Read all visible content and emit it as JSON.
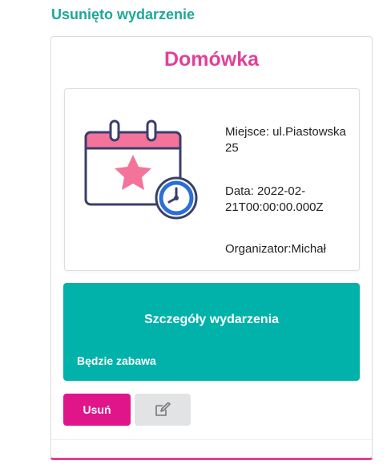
{
  "notice": "Usunięto wydarzenie",
  "event": {
    "title": "Domówka",
    "place": "Miejsce: ul.Piastowska 25",
    "date": "Data: 2022-02-21T00:00:00.000Z",
    "organizer": "Organizator:Michał",
    "details_heading": "Szczegóły wydarzenia",
    "description": "Będzie zabawa"
  },
  "actions": {
    "delete_label": "Usuń",
    "edit_icon": "edit-icon"
  },
  "colors": {
    "notice": "#1fa79a",
    "title": "#e2409a",
    "details_bg": "#00b2a9",
    "delete_bg": "#e0158a",
    "edit_bg": "#e2e3e5"
  }
}
